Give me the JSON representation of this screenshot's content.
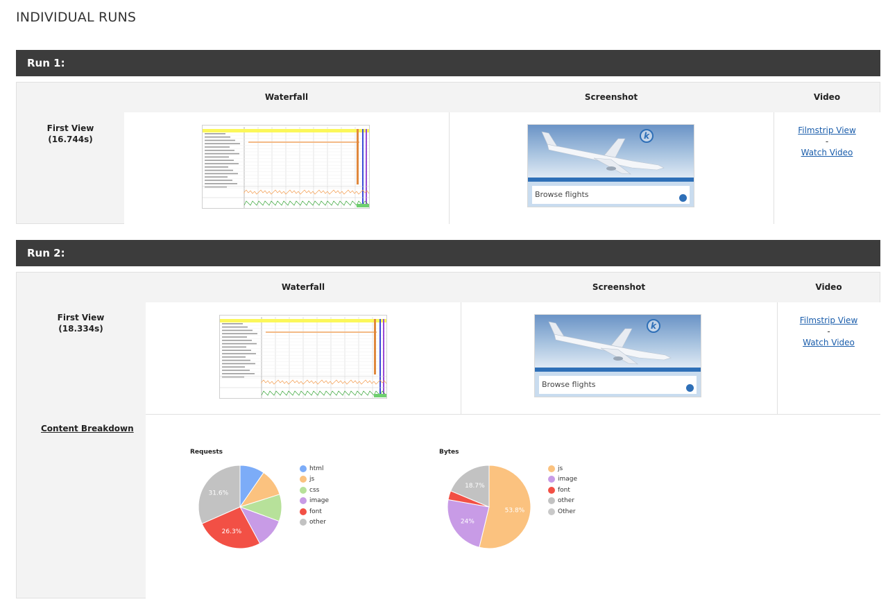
{
  "page": {
    "title": "INDIVIDUAL RUNS"
  },
  "runs": [
    {
      "header": "Run 1:",
      "columns": {
        "waterfall": "Waterfall",
        "screenshot": "Screenshot",
        "video": "Video"
      },
      "first_view": {
        "label": "First View",
        "time": "(16.744s)"
      },
      "screenshot": {
        "card_title": "Browse flights",
        "logo_glyph": "k"
      },
      "video": {
        "filmstrip": "Filmstrip View",
        "separator": "-",
        "watch": "Watch Video"
      }
    },
    {
      "header": "Run 2:",
      "columns": {
        "waterfall": "Waterfall",
        "screenshot": "Screenshot",
        "video": "Video"
      },
      "first_view": {
        "label": "First View",
        "time": "(18.334s)"
      },
      "screenshot": {
        "card_title": "Browse flights",
        "logo_glyph": "k"
      },
      "video": {
        "filmstrip": "Filmstrip View",
        "separator": "-",
        "watch": "Watch Video"
      },
      "content_breakdown": {
        "label": "Content Breakdown"
      }
    }
  ],
  "chart_data": [
    {
      "type": "pie",
      "title": "Requests",
      "slices": [
        {
          "label": "html",
          "value": 9.6,
          "color": "#7cacf8"
        },
        {
          "label": "js",
          "value": 10.5,
          "color": "#fbc27f"
        },
        {
          "label": "css",
          "value": 10.5,
          "color": "#b7e19a"
        },
        {
          "label": "image",
          "value": 11.5,
          "color": "#c89be6"
        },
        {
          "label": "font",
          "value": 26.3,
          "color": "#f25045"
        },
        {
          "label": "other",
          "value": 31.6,
          "color": "#c2c2c2"
        }
      ],
      "data_labels": [
        {
          "slice": "font",
          "text": "26.3%"
        },
        {
          "slice": "other",
          "text": "31.6%"
        }
      ],
      "legend_position": "right"
    },
    {
      "type": "pie",
      "title": "Bytes",
      "slices": [
        {
          "label": "js",
          "value": 53.8,
          "color": "#fbc27f"
        },
        {
          "label": "image",
          "value": 24,
          "color": "#c89be6"
        },
        {
          "label": "font",
          "value": 3.5,
          "color": "#f25045"
        },
        {
          "label": "other",
          "value": 18.7,
          "color": "#c2c2c2"
        },
        {
          "label": "Other",
          "value": 0,
          "color": "#c9c9c9"
        }
      ],
      "data_labels": [
        {
          "slice": "js",
          "text": "53.8%"
        },
        {
          "slice": "image",
          "text": "24%"
        },
        {
          "slice": "other",
          "text": "18.7%"
        }
      ],
      "legend_position": "right"
    }
  ]
}
